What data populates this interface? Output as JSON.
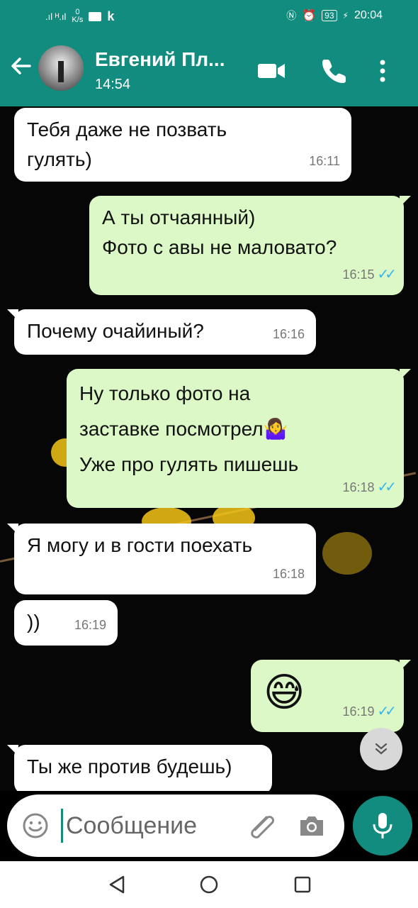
{
  "status_bar": {
    "left_signal": ".ıl ᴴ.ıl",
    "speed_value": "0",
    "speed_unit": "K/s",
    "k_label": "k",
    "battery": "93",
    "time": "20:04"
  },
  "header": {
    "contact_name": "Евгений Пл...",
    "last_seen": "14:54",
    "accent_color": "#128c7e"
  },
  "messages": [
    {
      "direction": "in",
      "text": "Тебя даже не позвать\nгулять)",
      "time": "16:11"
    },
    {
      "direction": "out",
      "text": "А ты отчаянный)\nФото с авы не маловато?",
      "time": "16:15",
      "read": true
    },
    {
      "direction": "in",
      "text": "Почему очайиный?",
      "time": "16:16"
    },
    {
      "direction": "out",
      "text": "Ну только фото на\nзаставке посмотрел🤷‍♀️\nУже про гулять пишешь",
      "time": "16:18",
      "read": true
    },
    {
      "direction": "in",
      "text": "Я могу и в гости поехать",
      "time": "16:18"
    },
    {
      "direction": "in",
      "text": "))",
      "time": "16:19"
    },
    {
      "direction": "out",
      "text": "😅",
      "time": "16:19",
      "read": true
    },
    {
      "direction": "in",
      "text": "Ты же против будешь)",
      "time": ""
    }
  ],
  "composer": {
    "placeholder": "Сообщение"
  },
  "icons": {
    "back": "arrow-left-icon",
    "video": "video-call-icon",
    "call": "phone-icon",
    "menu": "more-vertical-icon",
    "emoji": "emoji-icon",
    "attach": "paperclip-icon",
    "camera": "camera-icon",
    "mic": "microphone-icon"
  }
}
